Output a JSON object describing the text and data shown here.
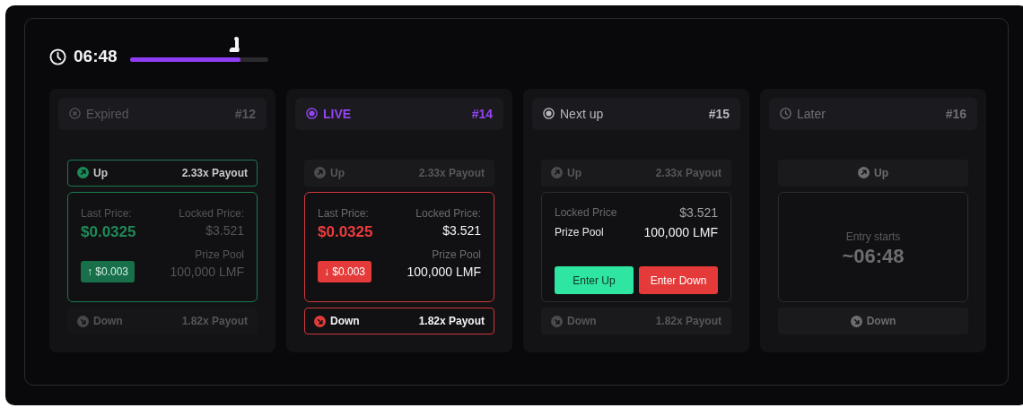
{
  "timer": {
    "time": "06:48",
    "level": 0.8
  },
  "rounds": [
    {
      "kind": "expired",
      "status": "Expired",
      "number": "#12",
      "up": {
        "label": "Up",
        "payout": "2.33x Payout",
        "highlighted": true
      },
      "down": {
        "label": "Down",
        "payout": "1.82x Payout",
        "highlighted": false
      },
      "last_price_label": "Last Price:",
      "last_price": "$0.0325",
      "change": "↑ $0.003",
      "locked_label": "Locked Price:",
      "locked_price": "$3.521",
      "pool_label": "Prize Pool",
      "pool": "100,000 LMF"
    },
    {
      "kind": "live",
      "status": "LIVE",
      "number": "#14",
      "up": {
        "label": "Up",
        "payout": "2.33x Payout",
        "highlighted": false
      },
      "down": {
        "label": "Down",
        "payout": "1.82x Payout",
        "highlighted": true
      },
      "last_price_label": "Last Price:",
      "last_price": "$0.0325",
      "change": "↓ $0.003",
      "locked_label": "Locked Price:",
      "locked_price": "$3.521",
      "pool_label": "Prize Pool",
      "pool": "100,000 LMF"
    },
    {
      "kind": "next",
      "status": "Next up",
      "number": "#15",
      "up": {
        "label": "Up",
        "payout": "2.33x Payout"
      },
      "down": {
        "label": "Down",
        "payout": "1.82x Payout"
      },
      "locked_label": "Locked Price",
      "locked_price": "$3.521",
      "pool_label": "Prize Pool",
      "pool": "100,000 LMF",
      "buttons": [
        "Enter Up",
        "Enter Down"
      ]
    },
    {
      "kind": "later",
      "status": "Later",
      "number": "#16",
      "up": {
        "label": "Up"
      },
      "down": {
        "label": "Down"
      },
      "entry_label": "Entry starts",
      "entry_time": "~06:48"
    }
  ]
}
